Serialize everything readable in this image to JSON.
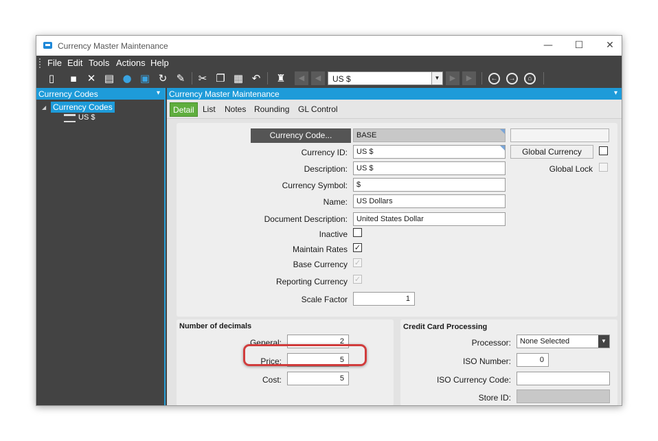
{
  "window": {
    "title": "Currency Master Maintenance",
    "minimize": "—",
    "maximize": "☐",
    "close": "✕"
  },
  "menu": [
    "File",
    "Edit",
    "Tools",
    "Actions",
    "Help"
  ],
  "toolbar": {
    "code_value": "US $"
  },
  "left_pane": {
    "header": "Currency Codes",
    "tree_root": "Currency Codes",
    "tree_child": "US $"
  },
  "right_pane": {
    "header": "Currency Master Maintenance"
  },
  "tabs": [
    "Detail",
    "List",
    "Notes",
    "Rounding",
    "GL Control"
  ],
  "detail": {
    "currency_code_button": "Currency Code...",
    "currency_code_value": "BASE",
    "currency_id_label": "Currency ID:",
    "currency_id_value": "US $",
    "description_label": "Description:",
    "description_value": "US $",
    "symbol_label": "Currency Symbol:",
    "symbol_value": "$",
    "name_label": "Name:",
    "name_value": "US Dollars",
    "doc_desc_label": "Document Description:",
    "doc_desc_value": "United States Dollar",
    "inactive_label": "Inactive",
    "maintain_rates_label": "Maintain Rates",
    "base_currency_label": "Base Currency",
    "reporting_currency_label": "Reporting Currency",
    "scale_factor_label": "Scale Factor",
    "scale_factor_value": "1",
    "global_currency_button": "Global Currency",
    "global_lock_label": "Global Lock",
    "checked_mark": "✓"
  },
  "decimals": {
    "title": "Number of decimals",
    "general_label": "General:",
    "general_value": "2",
    "price_label": "Price:",
    "price_value": "5",
    "cost_label": "Cost:",
    "cost_value": "5"
  },
  "credit_card": {
    "title": "Credit Card Processing",
    "processor_label": "Processor:",
    "processor_value": "None Selected",
    "iso_number_label": "ISO Number:",
    "iso_number_value": "0",
    "iso_currency_label": "ISO Currency Code:",
    "iso_currency_value": "",
    "store_id_label": "Store ID:"
  },
  "colors": {
    "accent_blue": "#1e9bd9",
    "active_tab_green": "#5fae3e",
    "highlight_red": "#d13c3c",
    "dark_chrome": "#434343"
  },
  "icons": [
    "new-icon",
    "save-icon",
    "delete-icon",
    "book-icon",
    "chat-icon",
    "attach-icon",
    "refresh-icon",
    "clear-icon",
    "cut-icon",
    "copy-icon",
    "paste-icon",
    "undo-icon",
    "search-binoculars-icon",
    "first-record-icon",
    "prev-record-icon",
    "next-record-icon",
    "last-record-icon",
    "back-icon",
    "forward-icon",
    "home-icon"
  ]
}
